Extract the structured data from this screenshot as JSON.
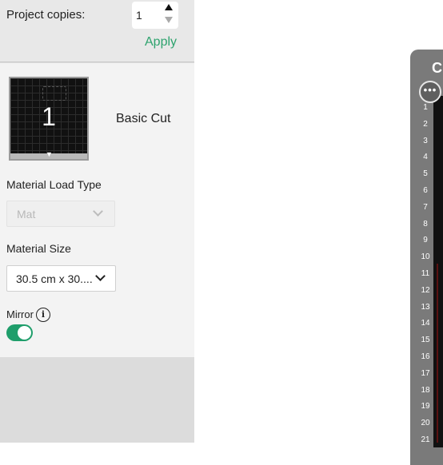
{
  "copies": {
    "label": "Project copies:",
    "value": "1",
    "apply_label": "Apply"
  },
  "mat": {
    "number": "1",
    "name": "Basic Cut"
  },
  "material_load": {
    "label": "Material Load Type",
    "value": "Mat"
  },
  "material_size": {
    "label": "Material Size",
    "value": "30.5 cm x 30...."
  },
  "mirror": {
    "label": "Mirror",
    "info_glyph": "i",
    "enabled": true
  },
  "preview": {
    "title_partial": "C",
    "more_glyph": "•••",
    "ruler": [
      "1",
      "2",
      "3",
      "4",
      "5",
      "6",
      "7",
      "8",
      "9",
      "10",
      "11",
      "12",
      "13",
      "14",
      "15",
      "16",
      "17",
      "18",
      "19",
      "20",
      "21"
    ]
  },
  "colors": {
    "accent": "#2ea36e",
    "toggle_on": "#1f9e6b",
    "panel": "#f3f3f3",
    "mat": "#111111"
  },
  "icons": [
    "spinner-up-icon",
    "spinner-down-icon",
    "chevron-down-icon",
    "info-icon",
    "more-icon"
  ]
}
